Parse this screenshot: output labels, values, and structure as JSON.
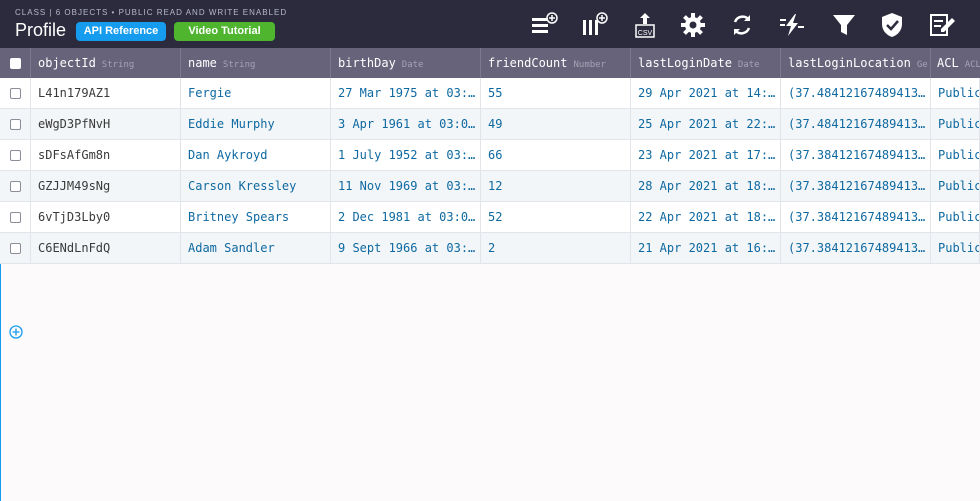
{
  "header": {
    "subtitle": "CLASS | 6 OBJECTS • PUBLIC READ AND WRITE ENABLED",
    "title": "Profile",
    "api_label": "API Reference",
    "video_label": "Video Tutorial",
    "tools": [
      "add-row-icon",
      "add-column-icon",
      "export-csv-icon",
      "gear-icon",
      "refresh-icon",
      "trigger-icon",
      "filter-icon",
      "shield-check-icon",
      "edit-icon"
    ]
  },
  "columns": [
    {
      "name": "objectId",
      "type": "String"
    },
    {
      "name": "name",
      "type": "String"
    },
    {
      "name": "birthDay",
      "type": "Date"
    },
    {
      "name": "friendCount",
      "type": "Number"
    },
    {
      "name": "lastLoginDate",
      "type": "Date"
    },
    {
      "name": "lastLoginLocation",
      "type": "Ge"
    },
    {
      "name": "ACL",
      "type": "ACL"
    }
  ],
  "rows": [
    {
      "objectId": "L41n179AZ1",
      "name": "Fergie",
      "birthDay": "27 Mar 1975 at 03:…",
      "friendCount": "55",
      "lastLoginDate": "29 Apr 2021 at 14:…",
      "lastLoginLocation": "(37.48412167489413…",
      "acl": "Public"
    },
    {
      "objectId": "eWgD3PfNvH",
      "name": "Eddie Murphy",
      "birthDay": "3 Apr 1961 at 03:0…",
      "friendCount": "49",
      "lastLoginDate": "25 Apr 2021 at 22:…",
      "lastLoginLocation": "(37.48412167489413…",
      "acl": "Public"
    },
    {
      "objectId": "sDFsAfGm8n",
      "name": "Dan Aykroyd",
      "birthDay": "1 July 1952 at 03:…",
      "friendCount": "66",
      "lastLoginDate": "23 Apr 2021 at 17:…",
      "lastLoginLocation": "(37.38412167489413…",
      "acl": "Public"
    },
    {
      "objectId": "GZJJM49sNg",
      "name": "Carson Kressley",
      "birthDay": "11 Nov 1969 at 03:…",
      "friendCount": "12",
      "lastLoginDate": "28 Apr 2021 at 18:…",
      "lastLoginLocation": "(37.38412167489413…",
      "acl": "Public"
    },
    {
      "objectId": "6vTjD3Lby0",
      "name": "Britney Spears",
      "birthDay": "2 Dec 1981 at 03:0…",
      "friendCount": "52",
      "lastLoginDate": "22 Apr 2021 at 18:…",
      "lastLoginLocation": "(37.38412167489413…",
      "acl": "Public"
    },
    {
      "objectId": "C6ENdLnFdQ",
      "name": "Adam Sandler",
      "birthDay": "9 Sept 1966 at 03:…",
      "friendCount": "2",
      "lastLoginDate": "21 Apr 2021 at 16:…",
      "lastLoginLocation": "(37.38412167489413…",
      "acl": "Public"
    }
  ],
  "colors": {
    "header_bg": "#2b2b3d",
    "column_bg": "#66637a",
    "api": "#169cee",
    "video": "#4fb52f",
    "value": "#0e69a1"
  }
}
